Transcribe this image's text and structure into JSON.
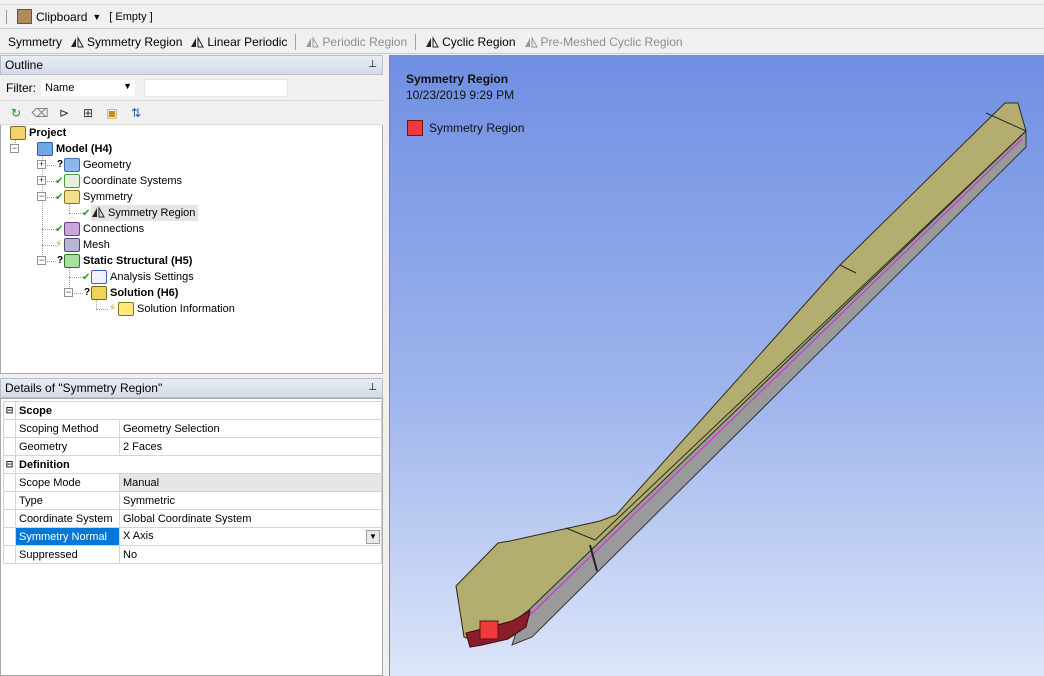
{
  "toolbar1": {
    "clipboard_label": "Clipboard",
    "clipboard_value": "[ Empty ]"
  },
  "toolbar2": {
    "items": [
      {
        "label": "Symmetry",
        "enabled": true
      },
      {
        "label": "Symmetry Region",
        "enabled": true
      },
      {
        "label": "Linear Periodic",
        "enabled": true
      },
      {
        "label": "Periodic Region",
        "enabled": false
      },
      {
        "label": "Cyclic Region",
        "enabled": true
      },
      {
        "label": "Pre-Meshed Cyclic Region",
        "enabled": false
      }
    ]
  },
  "outline": {
    "title": "Outline",
    "filter_label": "Filter:",
    "filter_value": "Name",
    "filter_text": "",
    "tree": [
      {
        "label": "Project",
        "bold": true,
        "icon": "project-icon"
      },
      {
        "label": "Model (H4)",
        "bold": true,
        "icon": "model-icon"
      },
      {
        "label": "Geometry",
        "bold": false,
        "icon": "geometry-icon",
        "status": "?"
      },
      {
        "label": "Coordinate Systems",
        "bold": false,
        "icon": "coordinate-systems-icon",
        "status": "check"
      },
      {
        "label": "Symmetry",
        "bold": false,
        "icon": "symmetry-icon",
        "status": "check"
      },
      {
        "label": "Symmetry Region",
        "bold": false,
        "icon": "symmetry-region-icon",
        "status": "check",
        "selected": true
      },
      {
        "label": "Connections",
        "bold": false,
        "icon": "connections-icon",
        "status": "check"
      },
      {
        "label": "Mesh",
        "bold": false,
        "icon": "mesh-icon",
        "status": "bolt"
      },
      {
        "label": "Static Structural (H5)",
        "bold": true,
        "icon": "static-structural-icon",
        "status": "?"
      },
      {
        "label": "Analysis Settings",
        "bold": false,
        "icon": "analysis-settings-icon",
        "status": "check"
      },
      {
        "label": "Solution (H6)",
        "bold": true,
        "icon": "solution-icon",
        "status": "?"
      },
      {
        "label": "Solution Information",
        "bold": false,
        "icon": "solution-information-icon",
        "status": "bolt"
      }
    ]
  },
  "details": {
    "title": "Details of \"Symmetry Region\"",
    "sections": [
      {
        "name": "Scope",
        "rows": [
          {
            "key": "Scoping Method",
            "value": "Geometry Selection"
          },
          {
            "key": "Geometry",
            "value": "2 Faces"
          }
        ]
      },
      {
        "name": "Definition",
        "rows": [
          {
            "key": "Scope Mode",
            "value": "Manual"
          },
          {
            "key": "Type",
            "value": "Symmetric"
          },
          {
            "key": "Coordinate System",
            "value": "Global Coordinate System"
          },
          {
            "key": "Symmetry Normal",
            "value": "X Axis"
          },
          {
            "key": "Suppressed",
            "value": "No"
          }
        ]
      }
    ]
  },
  "viewport": {
    "title": "Symmetry Region",
    "date": "10/23/2019 9:29 PM",
    "legend_label": "Symmetry Region",
    "legend_color": "#ee3a3a",
    "geometry_color": "#b3ad6f"
  }
}
